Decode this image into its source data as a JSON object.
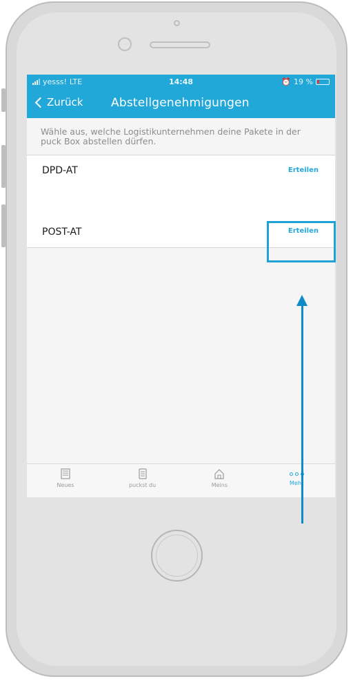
{
  "status_bar": {
    "carrier": "yesss!",
    "network": "LTE",
    "time": "14:48",
    "battery": "19 %"
  },
  "nav": {
    "back_label": "Zurück",
    "title": "Abstellgenehmigungen"
  },
  "intro_text": "Wähle aus, welche Logistikunternehmen deine Pakete in der puck Box abstellen dürfen.",
  "carriers": [
    {
      "name": "DPD-AT",
      "action": "Erteilen"
    },
    {
      "name": "POST-AT",
      "action": "Erteilen"
    }
  ],
  "tabs": [
    {
      "label": "Neues",
      "icon": "newspaper-icon"
    },
    {
      "label": "puckst du",
      "icon": "box-icon"
    },
    {
      "label": "Meins",
      "icon": "home-icon"
    },
    {
      "label": "Mehr",
      "icon": "more-dots-icon"
    }
  ],
  "colors": {
    "accent": "#22a8d8",
    "annotation": "#1ea3d8"
  }
}
